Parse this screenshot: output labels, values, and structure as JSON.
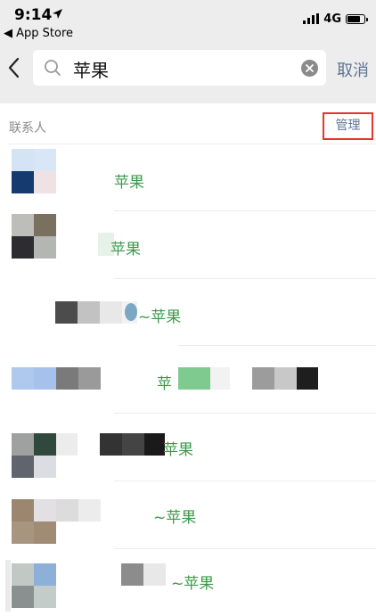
{
  "status_bar": {
    "time": "9:14",
    "back_app": "App Store",
    "network": "4G"
  },
  "search": {
    "query": "苹果",
    "cancel_label": "取消"
  },
  "section": {
    "title": "联系人",
    "manage_label": "管理"
  },
  "contacts": [
    {
      "name": "苹果"
    },
    {
      "name": "苹果"
    },
    {
      "name": "~苹果"
    },
    {
      "name": "苹"
    },
    {
      "name": "苹果"
    },
    {
      "name": "~苹果"
    },
    {
      "name": "~苹果"
    }
  ]
}
